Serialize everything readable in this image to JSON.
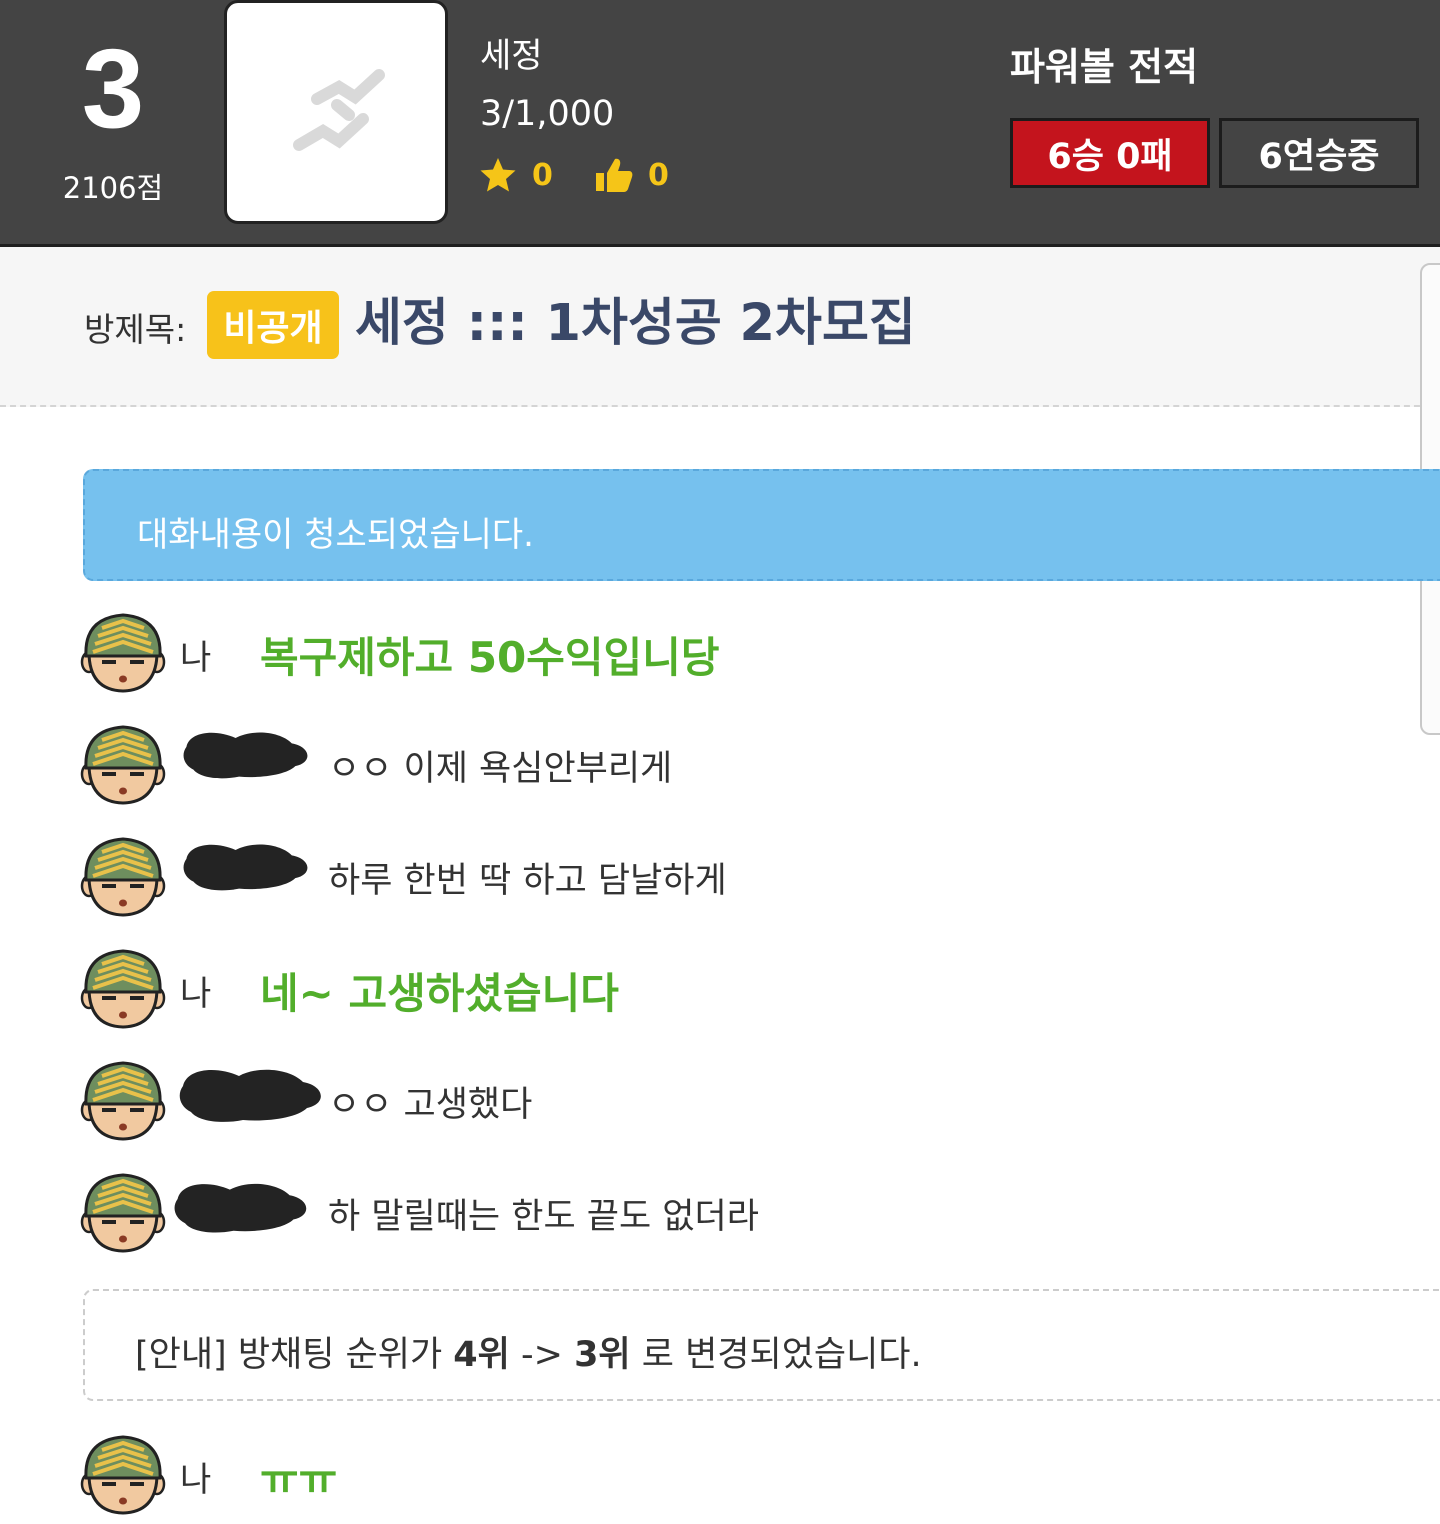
{
  "header": {
    "rank": "3",
    "score": "2106점",
    "room_name": "세정",
    "member_count": "3/1,000",
    "stars": "0",
    "likes": "0",
    "record_title": "파워볼 전적",
    "win_loss": "6승 0패",
    "streak": "6연승중"
  },
  "room": {
    "title_label": "방제목:",
    "private_badge": "비공개",
    "title": "세정 ::: 1차성공 2차모집"
  },
  "notice_cleared": "대화내용이 청소되었습니다.",
  "chat": [
    {
      "nick": "나",
      "message": "복구제하고 50수익입니당",
      "mine": true
    },
    {
      "nick": "",
      "message": "ㅇㅇ 이제 욕심안부리게",
      "mine": false
    },
    {
      "nick": "",
      "message": "하루 한번 딱 하고 담날하게",
      "mine": false
    },
    {
      "nick": "나",
      "message": "네~ 고생하셨습니다",
      "mine": true
    },
    {
      "nick": "",
      "message": "ㅇㅇ 고생했다",
      "mine": false
    },
    {
      "nick": "",
      "message": "하 말릴때는 한도 끝도 없더라",
      "mine": false
    }
  ],
  "notice_rank": {
    "prefix": "[안내] 방채팅 순위가 ",
    "from": "4위",
    "arrow": " -> ",
    "to": "3위",
    "suffix": " 로 변경되었습니다."
  },
  "chat_last": {
    "nick": "나",
    "message": "ㅠㅠ",
    "mine": true
  },
  "colors": {
    "header_bg": "#444444",
    "win_badge": "#c4141d",
    "private_badge": "#f7c21a",
    "my_message": "#52ae2b",
    "notice_blue": "#76c1ee",
    "title_text": "#3a4868"
  },
  "icons": {
    "star": "star-icon",
    "like": "thumbs-up-icon",
    "avatar": "soldier-avatar-icon",
    "placeholder": "broken-image-icon"
  }
}
